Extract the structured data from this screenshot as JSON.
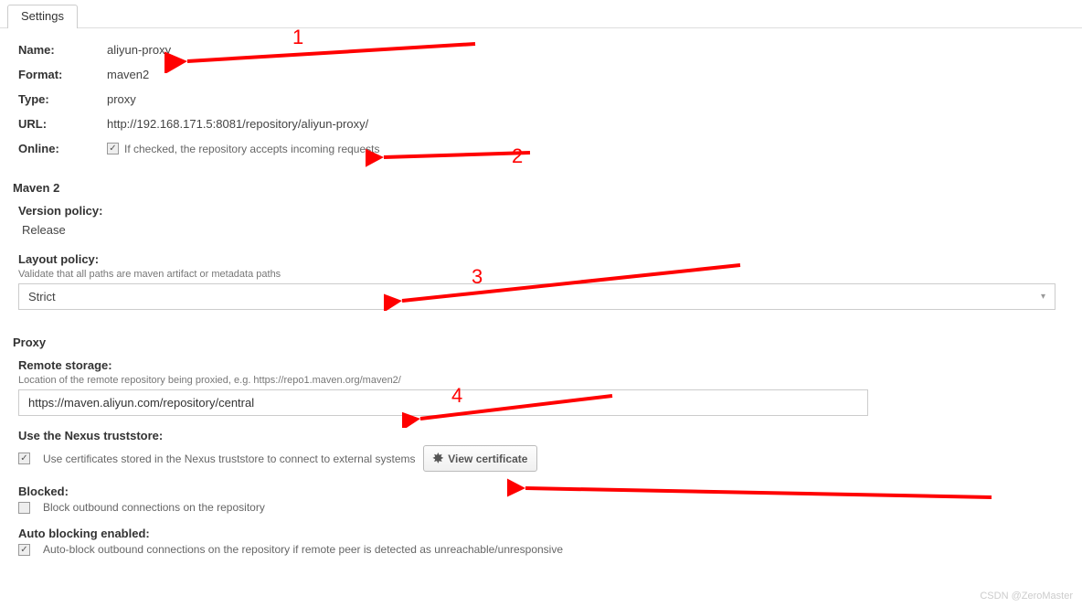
{
  "tab": {
    "label": "Settings"
  },
  "info": {
    "name_label": "Name:",
    "name_value": "aliyun-proxy",
    "format_label": "Format:",
    "format_value": "maven2",
    "type_label": "Type:",
    "type_value": "proxy",
    "url_label": "URL:",
    "url_value": "http://192.168.171.5:8081/repository/aliyun-proxy/",
    "online_label": "Online:",
    "online_hint": "If checked, the repository accepts incoming requests"
  },
  "maven2": {
    "title": "Maven 2",
    "version_policy_label": "Version policy:",
    "version_policy_value": "Release",
    "layout_policy_label": "Layout policy:",
    "layout_policy_hint": "Validate that all paths are maven artifact or metadata paths",
    "layout_policy_value": "Strict"
  },
  "proxy": {
    "title": "Proxy",
    "remote_storage_label": "Remote storage:",
    "remote_storage_hint": "Location of the remote repository being proxied, e.g. https://repo1.maven.org/maven2/",
    "remote_storage_value": "https://maven.aliyun.com/repository/central",
    "truststore_label": "Use the Nexus truststore:",
    "truststore_hint": "Use certificates stored in the Nexus truststore to connect to external systems",
    "view_cert_label": "View certificate",
    "blocked_label": "Blocked:",
    "blocked_hint": "Block outbound connections on the repository",
    "autoblock_label": "Auto blocking enabled:",
    "autoblock_hint": "Auto-block outbound connections on the repository if remote peer is detected as unreachable/unresponsive"
  },
  "annotations": {
    "n1": "1",
    "n2": "2",
    "n3": "3",
    "n4": "4"
  },
  "watermark": "CSDN @ZeroMaster"
}
